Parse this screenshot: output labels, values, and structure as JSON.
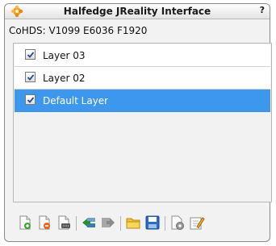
{
  "window": {
    "title": "Halfedge JReality Interface",
    "help_label": "?"
  },
  "stats": {
    "text": "CoHDS: V1099 E6036 F1920"
  },
  "layers": [
    {
      "label": "Layer 03",
      "checked": true,
      "selected": false
    },
    {
      "label": "Layer 02",
      "checked": true,
      "selected": false
    },
    {
      "label": "Default Layer",
      "checked": true,
      "selected": true
    }
  ],
  "toolbar": {
    "buttons": [
      {
        "icon": "new-layer-icon"
      },
      {
        "icon": "delete-layer-icon"
      },
      {
        "icon": "layer-properties-icon"
      },
      {
        "icon": "move-layer-left-icon"
      },
      {
        "icon": "move-layer-right-icon"
      },
      {
        "icon": "open-folder-icon"
      },
      {
        "icon": "save-disk-icon"
      },
      {
        "icon": "settings-gear-icon"
      },
      {
        "icon": "edit-icon"
      }
    ]
  },
  "colors": {
    "selection": "#3d97ec",
    "panel_bg": "#f2f2f2"
  }
}
